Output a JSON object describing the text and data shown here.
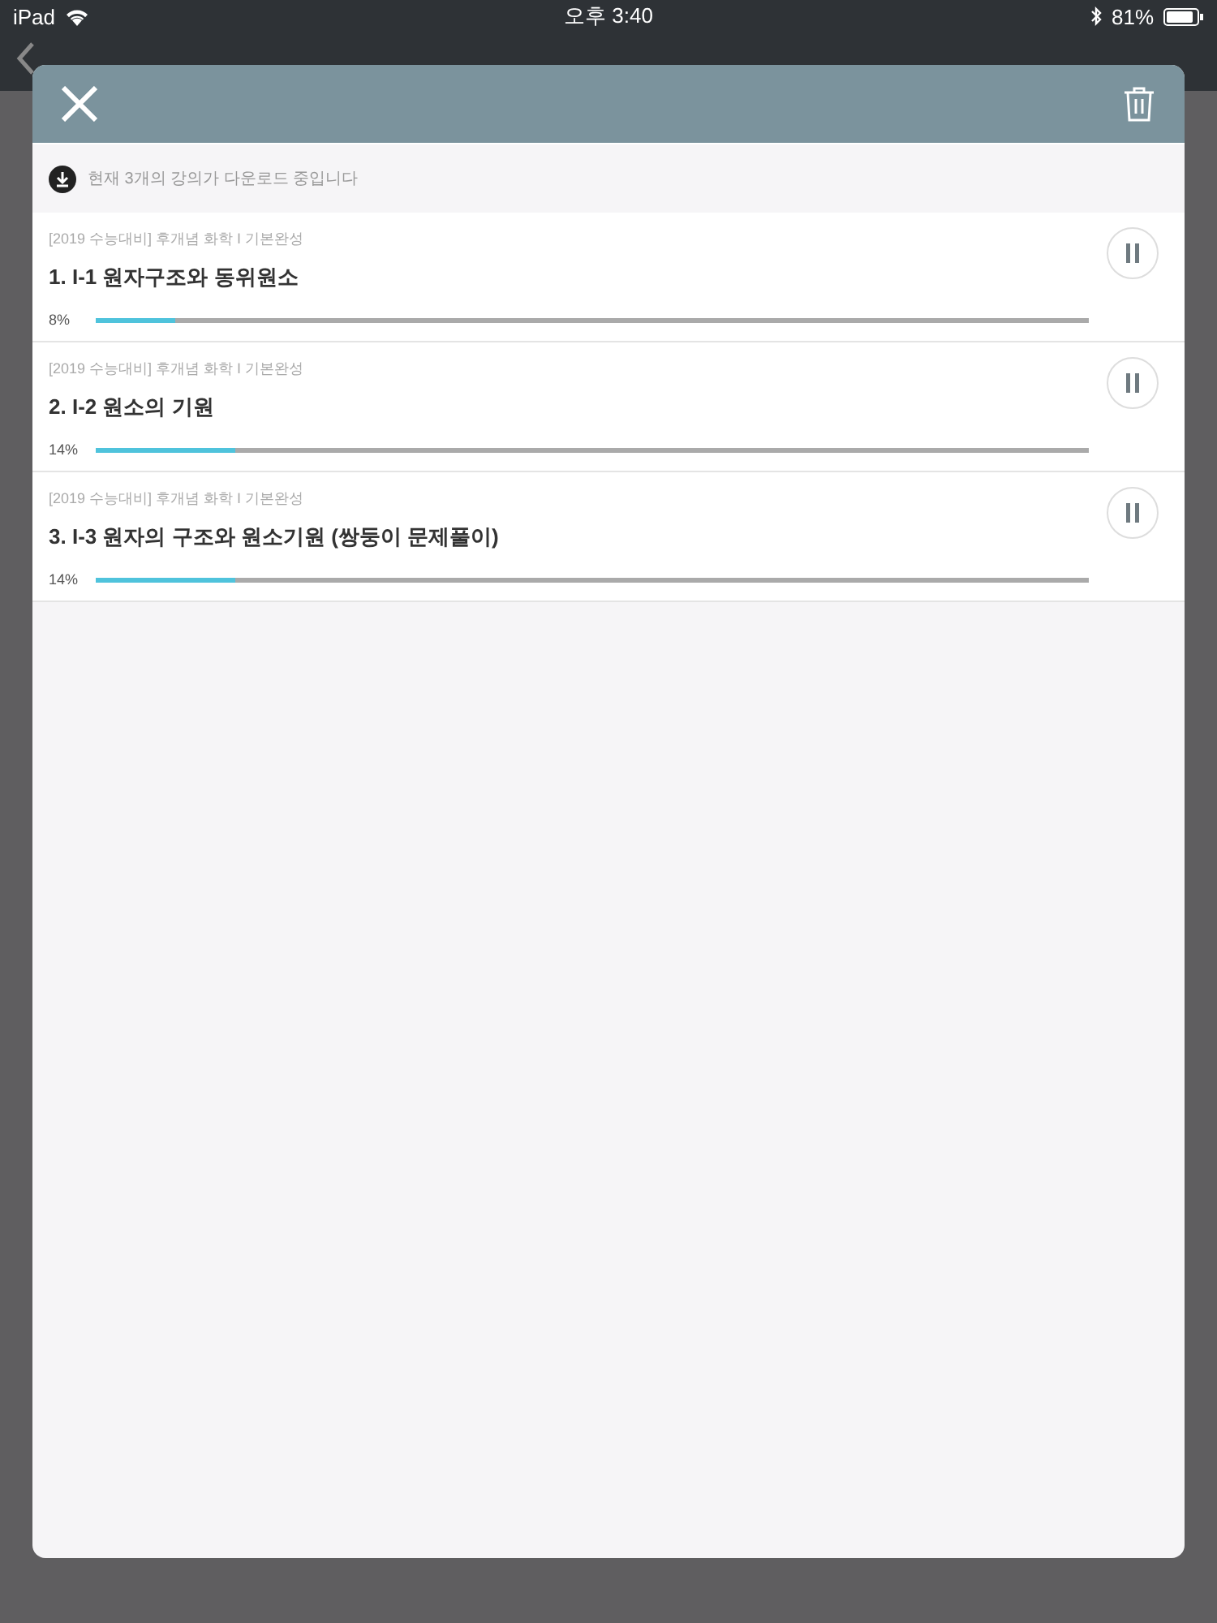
{
  "status_bar": {
    "device": "iPad",
    "time": "오후 3:40",
    "battery": "81%"
  },
  "download_panel": {
    "notice": "현재 3개의 강의가 다운로드 중입니다",
    "items": [
      {
        "course": "[2019 수능대비] 후개념 화학 I 기본완성",
        "title": "1. I-1 원자구조와 동위원소",
        "percent": "8%",
        "level": 0.08
      },
      {
        "course": "[2019 수능대비] 후개념 화학 I 기본완성",
        "title": "2. I-2 원소의 기원",
        "percent": "14%",
        "level": 0.14
      },
      {
        "course": "[2019 수능대비] 후개념 화학 I 기본완성",
        "title": "3. I-3 원자의 구조와 원소기원 (쌍둥이 문제풀이)",
        "percent": "14%",
        "level": 0.14
      }
    ]
  }
}
